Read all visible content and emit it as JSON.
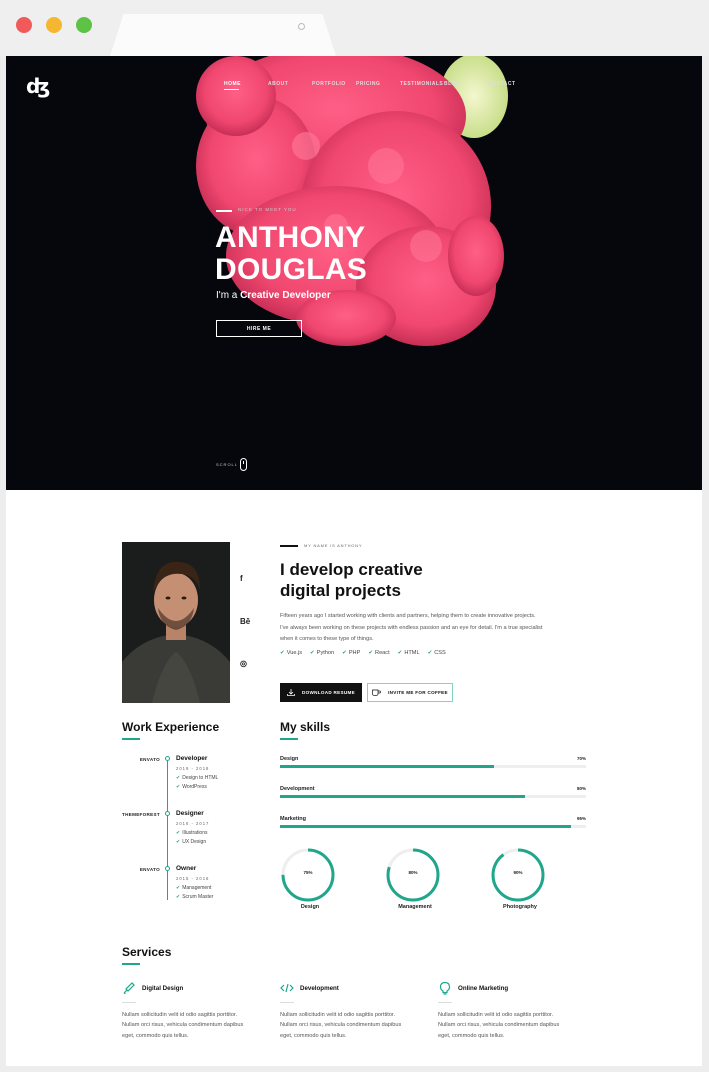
{
  "browser": {
    "window_controls": [
      "close",
      "minimize",
      "maximize"
    ]
  },
  "hero": {
    "logo": "ʤ",
    "nav": [
      "Home",
      "About",
      "Portfolio",
      "Pricing",
      "Testimonials",
      "Blog",
      "Contact"
    ],
    "kicker": "Nice to meet you",
    "name_line1": "ANTHONY",
    "name_line2": "DOUGLAS",
    "subtitle_prefix": "I'm a ",
    "subtitle_bold": "Creative Developer",
    "cta": "HIRE ME",
    "scroll": "SCROLL"
  },
  "about": {
    "kicker": "My name is Anthony",
    "title_line1": "I develop creative",
    "title_line2": "digital projects",
    "body_line1": "Fifteen years ago I started working with clients and partners, helping them to create innovative projects.",
    "body_line2": "I've always been working on these projects with endless passion and an eye for detail. I'm a true specialist",
    "body_line3": "when it comes to these type of things.",
    "tech": [
      "Vue.js",
      "Python",
      "PHP",
      "React",
      "HTML",
      "CSS"
    ],
    "social": [
      "f",
      "Bē",
      "◎"
    ],
    "download_label": "DOWNLOAD RESUME",
    "coffee_label": "INVITE ME FOR COFFEE"
  },
  "work": {
    "title": "Work Experience",
    "entries": [
      {
        "company": "ENVATO",
        "role": "Developer",
        "years": "2019 - 2018",
        "items": [
          "Design to HTML",
          "WordPress"
        ]
      },
      {
        "company": "THEMEFOREST",
        "role": "Designer",
        "years": "2016 - 2017",
        "items": [
          "Illustrations",
          "UX Design"
        ]
      },
      {
        "company": "ENVATO",
        "role": "Owner",
        "years": "2015 - 2016",
        "items": [
          "Management",
          "Scrum Master"
        ]
      }
    ]
  },
  "skills": {
    "title": "My skills",
    "bars": [
      {
        "label": "Design",
        "value": 70,
        "pct": "70%"
      },
      {
        "label": "Development",
        "value": 80,
        "pct": "80%"
      },
      {
        "label": "Marketing",
        "value": 95,
        "pct": "95%"
      }
    ],
    "rings": [
      {
        "label": "Design",
        "value": 75,
        "pct": "75%"
      },
      {
        "label": "Management",
        "value": 80,
        "pct": "80%"
      },
      {
        "label": "Photography",
        "value": 90,
        "pct": "90%"
      }
    ]
  },
  "services": {
    "title": "Services",
    "items": [
      {
        "icon": "brush-icon",
        "title": "Digital Design",
        "line1": "Nullam sollicitudin velit id odio sagittis porttitor.",
        "line2": "Nullam orci risus, vehicula condimentum dapibus",
        "line3": "eget, commodo quis tellus."
      },
      {
        "icon": "code-icon",
        "title": "Development",
        "line1": "Nullam sollicitudin velit id odio sagittis porttitor.",
        "line2": "Nullam orci risus, vehicula condimentum dapibus",
        "line3": "eget, commodo quis tellus."
      },
      {
        "icon": "bulb-icon",
        "title": "Online Marketing",
        "line1": "Nullam sollicitudin velit id odio sagittis porttitor.",
        "line2": "Nullam orci risus, vehicula condimentum dapibus",
        "line3": "eget, commodo quis tellus."
      }
    ]
  },
  "colors": {
    "accent": "#1fa68b",
    "hero_bg": "#05070d",
    "smoke": "#f0476f"
  }
}
